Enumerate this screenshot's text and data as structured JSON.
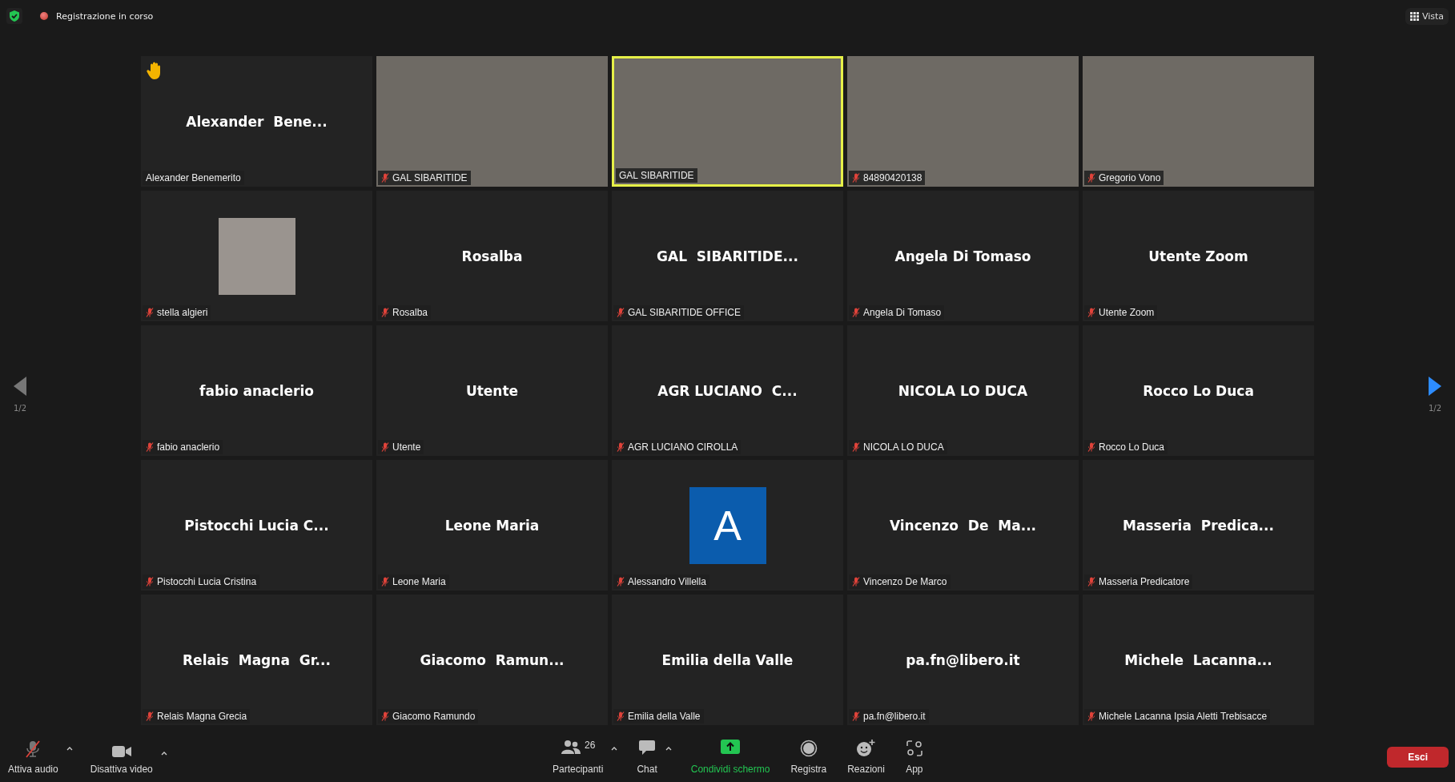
{
  "top_bar": {
    "recording_status": "Registrazione in corso",
    "view_button": "Vista"
  },
  "pager": {
    "left": {
      "page": "1/2",
      "enabled": false
    },
    "right": {
      "page": "1/2",
      "enabled": true
    }
  },
  "tiles": [
    {
      "kind": "name",
      "display_name": "Alexander  Bene...",
      "label": "Alexander Benemerito",
      "muted": false,
      "hand_raised": true,
      "speaking": false
    },
    {
      "kind": "video",
      "label": "GAL SIBARITIDE",
      "muted": true,
      "hand_raised": false,
      "speaking": false
    },
    {
      "kind": "video",
      "label": "GAL SIBARITIDE",
      "muted": false,
      "hand_raised": false,
      "speaking": true
    },
    {
      "kind": "video",
      "label": "84890420138",
      "muted": true,
      "hand_raised": false,
      "speaking": false
    },
    {
      "kind": "video",
      "label": "Gregorio Vono",
      "muted": true,
      "hand_raised": false,
      "speaking": false
    },
    {
      "kind": "photo",
      "label": "stella algieri",
      "muted": true,
      "hand_raised": false,
      "speaking": false
    },
    {
      "kind": "name",
      "display_name": "Rosalba",
      "label": "Rosalba",
      "muted": true,
      "hand_raised": false,
      "speaking": false
    },
    {
      "kind": "name",
      "display_name": "GAL  SIBARITIDE...",
      "label": "GAL SIBARITIDE OFFICE",
      "muted": true,
      "hand_raised": false,
      "speaking": false
    },
    {
      "kind": "name",
      "display_name": "Angela Di Tomaso",
      "label": "Angela Di Tomaso",
      "muted": true,
      "hand_raised": false,
      "speaking": false
    },
    {
      "kind": "name",
      "display_name": "Utente Zoom",
      "label": "Utente Zoom",
      "muted": true,
      "hand_raised": false,
      "speaking": false
    },
    {
      "kind": "name",
      "display_name": "fabio anaclerio",
      "label": "fabio anaclerio",
      "muted": true,
      "hand_raised": false,
      "speaking": false
    },
    {
      "kind": "name",
      "display_name": "Utente",
      "label": "Utente",
      "muted": true,
      "hand_raised": false,
      "speaking": false
    },
    {
      "kind": "name",
      "display_name": "AGR LUCIANO  C...",
      "label": "AGR LUCIANO CIROLLA",
      "muted": true,
      "hand_raised": false,
      "speaking": false
    },
    {
      "kind": "name",
      "display_name": "NICOLA LO DUCA",
      "label": "NICOLA LO DUCA",
      "muted": true,
      "hand_raised": false,
      "speaking": false
    },
    {
      "kind": "name",
      "display_name": "Rocco Lo Duca",
      "label": "Rocco Lo Duca",
      "muted": true,
      "hand_raised": false,
      "speaking": false
    },
    {
      "kind": "name",
      "display_name": "Pistocchi Lucia C...",
      "label": "Pistocchi Lucia Cristina",
      "muted": true,
      "hand_raised": false,
      "speaking": false
    },
    {
      "kind": "name",
      "display_name": "Leone Maria",
      "label": "Leone Maria",
      "muted": true,
      "hand_raised": false,
      "speaking": false
    },
    {
      "kind": "letter",
      "initial": "A",
      "label": "Alessandro Villella",
      "muted": true,
      "hand_raised": false,
      "speaking": false
    },
    {
      "kind": "name",
      "display_name": "Vincenzo  De  Ma...",
      "label": "Vincenzo De Marco",
      "muted": true,
      "hand_raised": false,
      "speaking": false
    },
    {
      "kind": "name",
      "display_name": "Masseria  Predica...",
      "label": "Masseria Predicatore",
      "muted": true,
      "hand_raised": false,
      "speaking": false
    },
    {
      "kind": "name",
      "display_name": "Relais  Magna  Gr...",
      "label": "Relais Magna Grecia",
      "muted": true,
      "hand_raised": false,
      "speaking": false
    },
    {
      "kind": "name",
      "display_name": "Giacomo  Ramun...",
      "label": "Giacomo Ramundo",
      "muted": true,
      "hand_raised": false,
      "speaking": false
    },
    {
      "kind": "name",
      "display_name": "Emilia della Valle",
      "label": "Emilia della Valle",
      "muted": true,
      "hand_raised": false,
      "speaking": false
    },
    {
      "kind": "name",
      "display_name": "pa.fn@libero.it",
      "label": "pa.fn@libero.it",
      "muted": true,
      "hand_raised": false,
      "speaking": false
    },
    {
      "kind": "name",
      "display_name": "Michele  Lacanna...",
      "label": "Michele Lacanna Ipsia Aletti Trebisacce",
      "muted": true,
      "hand_raised": false,
      "speaking": false
    }
  ],
  "toolbar": {
    "left": [
      {
        "kind": "audio",
        "label": "Attiva audio",
        "muted": true
      },
      {
        "kind": "video",
        "label": "Disattiva video",
        "muted": false
      }
    ],
    "center": [
      {
        "kind": "participants",
        "label": "Partecipanti",
        "count": "26",
        "caret": true,
        "active": false
      },
      {
        "kind": "chat",
        "label": "Chat",
        "caret": true,
        "active": false
      },
      {
        "kind": "share",
        "label": "Condividi schermo",
        "caret": false,
        "active": true
      },
      {
        "kind": "record",
        "label": "Registra",
        "caret": false,
        "active": false
      },
      {
        "kind": "reactions",
        "label": "Reazioni",
        "caret": false,
        "active": false
      },
      {
        "kind": "apps",
        "label": "App",
        "caret": false,
        "active": false
      }
    ],
    "leave_button": "Esci"
  }
}
